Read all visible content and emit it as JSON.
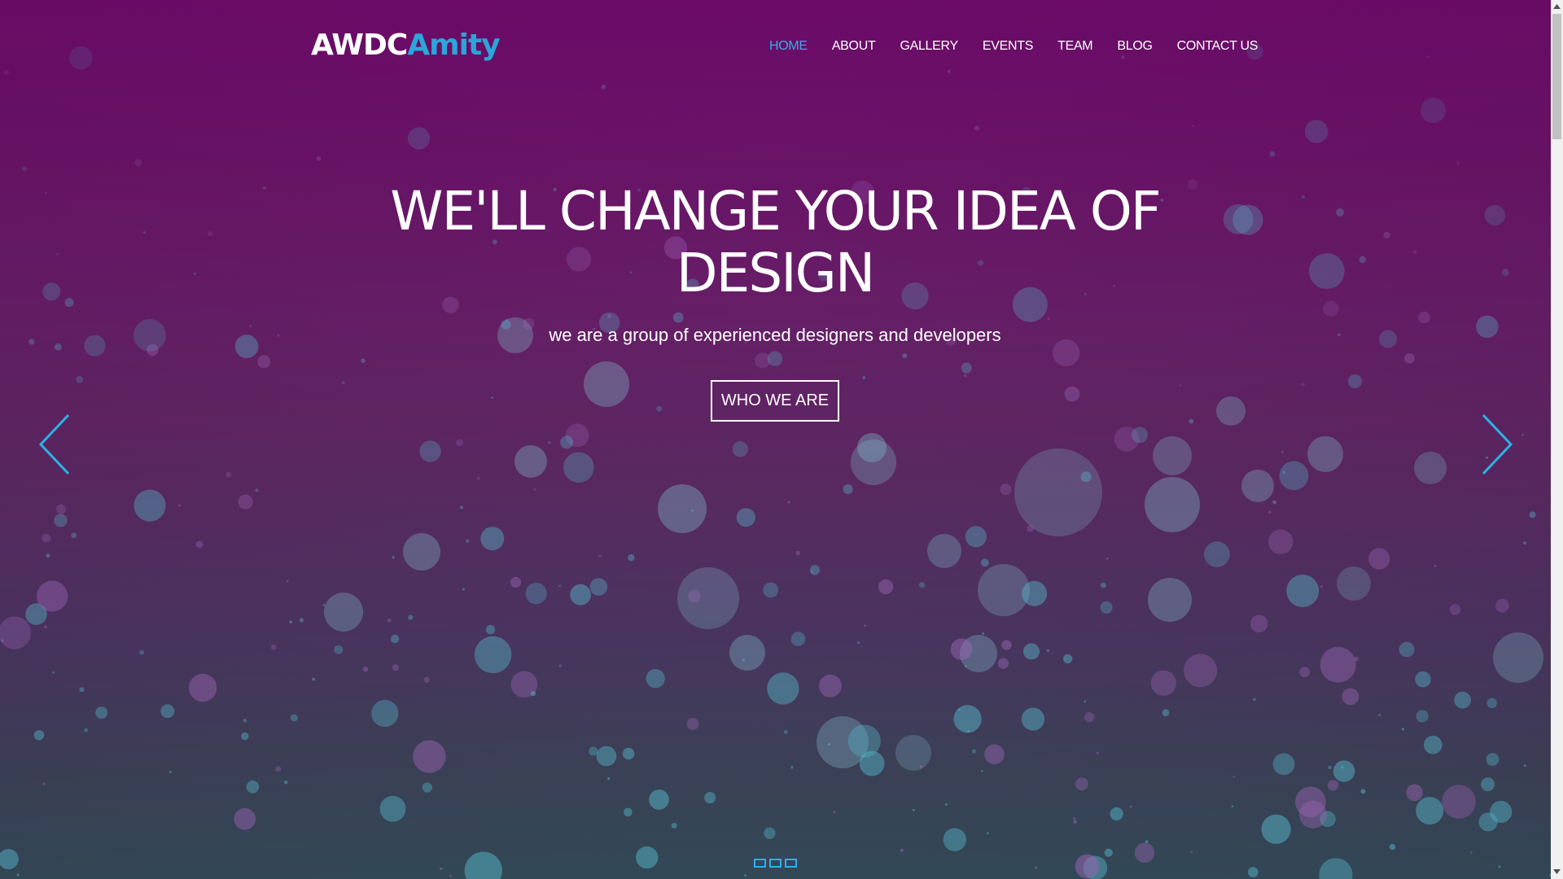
{
  "logo": {
    "part1": "AWDC",
    "part2": "Amity"
  },
  "nav": {
    "items": [
      {
        "label": "HOME",
        "active": true
      },
      {
        "label": "ABOUT",
        "active": false
      },
      {
        "label": "GALLERY",
        "active": false
      },
      {
        "label": "EVENTS",
        "active": false
      },
      {
        "label": "TEAM",
        "active": false
      },
      {
        "label": "BLOG",
        "active": false
      },
      {
        "label": "CONTACT US",
        "active": false
      }
    ]
  },
  "hero": {
    "headline_line1": "WE'LL CHANGE YOUR IDEA OF",
    "headline_line2": "DESIGN",
    "subline": "we are a group of experienced designers and developers",
    "cta_label": "WHO WE ARE"
  },
  "slider": {
    "prev_icon": "chevron-left-icon",
    "next_icon": "chevron-right-icon",
    "slide_count": 3
  },
  "colors": {
    "accent": "#2ab3e6",
    "logo_accent": "#2aa6d8",
    "text": "#ffffff",
    "bg_top": "#6e0b6a",
    "bg_bottom": "#30505a"
  }
}
